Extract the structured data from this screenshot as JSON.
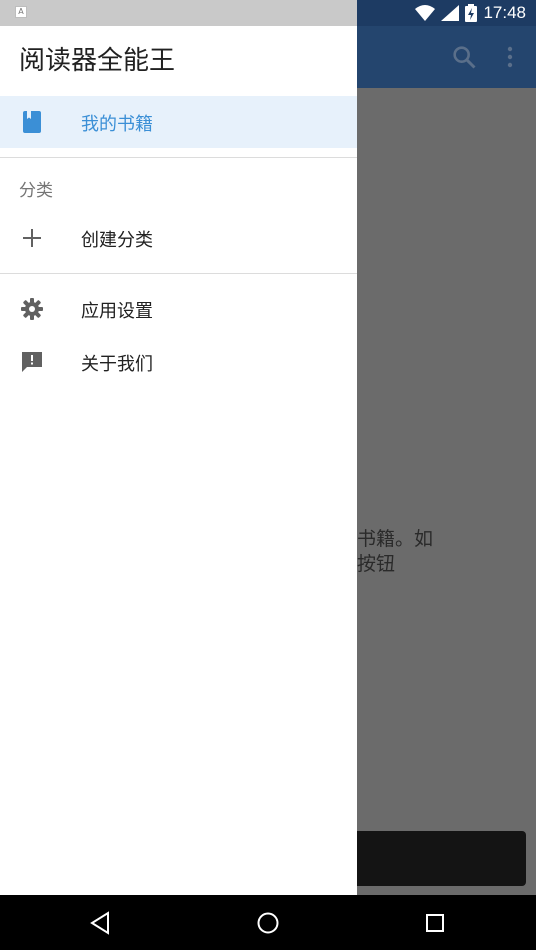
{
  "status_bar": {
    "time": "17:48",
    "app_badge": "A"
  },
  "drawer": {
    "title": "阅读器全能王",
    "items": [
      {
        "label": "我的书籍",
        "icon": "book-icon",
        "active": true
      },
      {
        "label": "创建分类",
        "icon": "plus-icon"
      },
      {
        "label": "应用设置",
        "icon": "gear-icon"
      },
      {
        "label": "关于我们",
        "icon": "feedback-icon"
      }
    ],
    "section_label": "分类"
  },
  "background_app": {
    "empty_text_line1": "书籍。如",
    "empty_text_line2": "按钮"
  },
  "colors": {
    "accent": "#3b8fd6",
    "appbar": "#24456e",
    "statusbar": "#1d3b63"
  }
}
